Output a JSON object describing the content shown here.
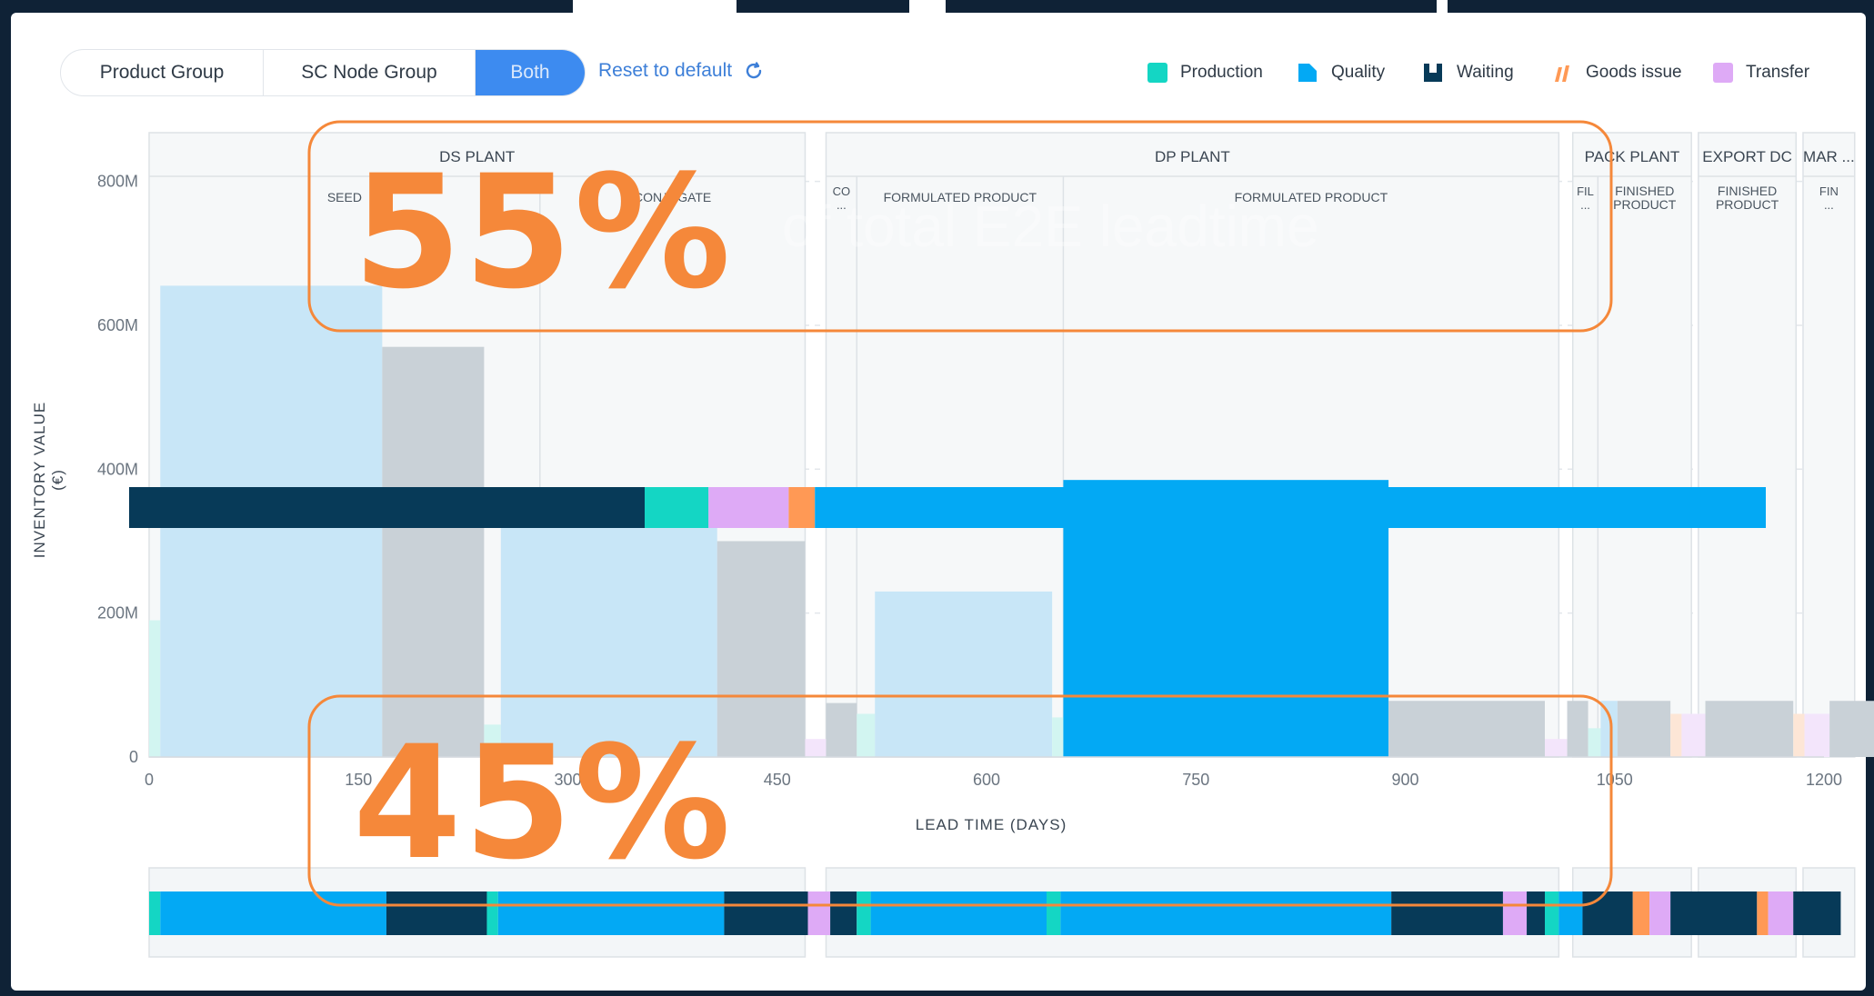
{
  "toolbar": {
    "segments": [
      "Product Group",
      "SC Node Group",
      "Both"
    ],
    "active_segment": "Both",
    "reset_label": "Reset to default"
  },
  "legend": [
    {
      "label": "Production",
      "color": "#14d6c4"
    },
    {
      "label": "Quality",
      "color": "#03a9f4"
    },
    {
      "label": "Waiting",
      "color": "#073a58"
    },
    {
      "label": "Goods issue",
      "color": "#ff9955"
    },
    {
      "label": "Transfer",
      "color": "#deaaf6"
    }
  ],
  "overlay": {
    "top_percent": "55%",
    "bottom_percent": "45%",
    "ghost_text": "of total E2E leadtime"
  },
  "chart_data": {
    "type": "bar",
    "xlabel": "LEAD TIME (DAYS)",
    "ylabel": "INVENTORY VALUE (€)",
    "xlim": [
      0,
      1200
    ],
    "ylim": [
      0,
      850
    ],
    "x_ticks": [
      0,
      150,
      300,
      450,
      600,
      750,
      900,
      1050,
      1200
    ],
    "x_tick_labels": [
      "0",
      "150",
      "300",
      "450",
      "600",
      "750",
      "900",
      "1050",
      "1200"
    ],
    "y_ticks": [
      0,
      200,
      400,
      600,
      800
    ],
    "y_tick_labels": [
      "0",
      "200M",
      "400M",
      "600M",
      "800M"
    ],
    "grid": true,
    "stages": [
      {
        "label": "DS PLANT",
        "x0": 0,
        "x1": 470,
        "steps": [
          {
            "label": "SEED",
            "x0": 0,
            "x1": 280
          },
          {
            "label": "CONJUGATE",
            "x0": 280,
            "x1": 470
          }
        ]
      },
      {
        "label": "DP PLANT",
        "x0": 485,
        "x1": 1010,
        "steps": [
          {
            "label": "CO ...",
            "x0": 485,
            "x1": 507
          },
          {
            "label": "FORMULATED PRODUCT",
            "x0": 507,
            "x1": 655
          },
          {
            "label": "FORMULATED PRODUCT",
            "x0": 655,
            "x1": 1010
          }
        ]
      },
      {
        "label": "PACK PLANT",
        "x0": 1020,
        "x1": 1105,
        "steps": [
          {
            "label": "FIL ...",
            "x0": 1020,
            "x1": 1038
          },
          {
            "label": "FINISHED PRODUCT",
            "x0": 1038,
            "x1": 1105
          }
        ]
      },
      {
        "label": "EXPORT DC",
        "x0": 1110,
        "x1": 1180,
        "steps": [
          {
            "label": "FINISHED PRODUCT",
            "x0": 1110,
            "x1": 1180
          }
        ]
      },
      {
        "label": "MAR ...",
        "x0": 1185,
        "x1": 1222,
        "steps": [
          {
            "label": "FIN ...",
            "x0": 1185,
            "x1": 1222
          }
        ]
      }
    ],
    "bars": [
      {
        "category": "Production",
        "x0": 0,
        "x1": 8,
        "value": 190
      },
      {
        "category": "Quality",
        "x0": 8,
        "x1": 167,
        "value": 655
      },
      {
        "category": "Waiting",
        "x0": 167,
        "x1": 240,
        "value": 570
      },
      {
        "category": "Production",
        "x0": 240,
        "x1": 252,
        "value": 45
      },
      {
        "category": "Quality",
        "x0": 252,
        "x1": 407,
        "value": 365
      },
      {
        "category": "Waiting",
        "x0": 407,
        "x1": 470,
        "value": 300
      },
      {
        "category": "Transfer",
        "x0": 470,
        "x1": 485,
        "value": 25
      },
      {
        "category": "Waiting",
        "x0": 485,
        "x1": 507,
        "value": 75
      },
      {
        "category": "Production",
        "x0": 507,
        "x1": 520,
        "value": 60
      },
      {
        "category": "Quality",
        "x0": 520,
        "x1": 647,
        "value": 230
      },
      {
        "category": "Production",
        "x0": 647,
        "x1": 655,
        "value": 55
      },
      {
        "category": "Quality",
        "x0": 655,
        "x1": 888,
        "value": 385
      },
      {
        "category": "Waiting",
        "x0": 888,
        "x1": 1000,
        "value": 78
      },
      {
        "category": "Transfer",
        "x0": 1000,
        "x1": 1016,
        "value": 25
      },
      {
        "category": "Waiting",
        "x0": 1016,
        "x1": 1031,
        "value": 78
      },
      {
        "category": "Production",
        "x0": 1031,
        "x1": 1040,
        "value": 40
      },
      {
        "category": "Quality",
        "x0": 1040,
        "x1": 1052,
        "value": 78
      },
      {
        "category": "Waiting",
        "x0": 1052,
        "x1": 1090,
        "value": 78
      },
      {
        "category": "Goods issue",
        "x0": 1090,
        "x1": 1098,
        "value": 60
      },
      {
        "category": "Transfer",
        "x0": 1098,
        "x1": 1115,
        "value": 60
      },
      {
        "category": "Waiting",
        "x0": 1115,
        "x1": 1178,
        "value": 78
      },
      {
        "category": "Goods issue",
        "x0": 1178,
        "x1": 1186,
        "value": 60
      },
      {
        "category": "Transfer",
        "x0": 1186,
        "x1": 1204,
        "value": 60
      },
      {
        "category": "Waiting",
        "x0": 1204,
        "x1": 1241,
        "value": 78
      }
    ],
    "highlight_bar_category": "Quality",
    "highlight_bar_x0": 655,
    "highlight_bar_x1": 888,
    "summary_bar": [
      {
        "category": "Waiting",
        "share": 0.315
      },
      {
        "category": "Production",
        "share": 0.039
      },
      {
        "category": "Transfer",
        "share": 0.049
      },
      {
        "category": "Goods issue",
        "share": 0.016
      },
      {
        "category": "Quality",
        "share": 0.581
      }
    ],
    "timeline": [
      {
        "category": "Production",
        "x0": 0,
        "x1": 8
      },
      {
        "category": "Quality",
        "x0": 8,
        "x1": 170
      },
      {
        "category": "Waiting",
        "x0": 170,
        "x1": 242
      },
      {
        "category": "Production",
        "x0": 242,
        "x1": 250
      },
      {
        "category": "Quality",
        "x0": 250,
        "x1": 412
      },
      {
        "category": "Waiting",
        "x0": 412,
        "x1": 472
      },
      {
        "category": "Transfer",
        "x0": 472,
        "x1": 488
      },
      {
        "category": "Waiting",
        "x0": 488,
        "x1": 507
      },
      {
        "category": "Production",
        "x0": 507,
        "x1": 517
      },
      {
        "category": "Quality",
        "x0": 517,
        "x1": 643
      },
      {
        "category": "Production",
        "x0": 643,
        "x1": 653
      },
      {
        "category": "Quality",
        "x0": 653,
        "x1": 890
      },
      {
        "category": "Waiting",
        "x0": 890,
        "x1": 970
      },
      {
        "category": "Transfer",
        "x0": 970,
        "x1": 987
      },
      {
        "category": "Waiting",
        "x0": 987,
        "x1": 1000
      },
      {
        "category": "Production",
        "x0": 1000,
        "x1": 1010
      },
      {
        "category": "Quality",
        "x0": 1010,
        "x1": 1027
      },
      {
        "category": "Waiting",
        "x0": 1027,
        "x1": 1063
      },
      {
        "category": "Goods issue",
        "x0": 1063,
        "x1": 1075
      },
      {
        "category": "Transfer",
        "x0": 1075,
        "x1": 1090
      },
      {
        "category": "Waiting",
        "x0": 1090,
        "x1": 1152
      },
      {
        "category": "Goods issue",
        "x0": 1152,
        "x1": 1160
      },
      {
        "category": "Transfer",
        "x0": 1160,
        "x1": 1178
      },
      {
        "category": "Waiting",
        "x0": 1178,
        "x1": 1212
      }
    ]
  }
}
